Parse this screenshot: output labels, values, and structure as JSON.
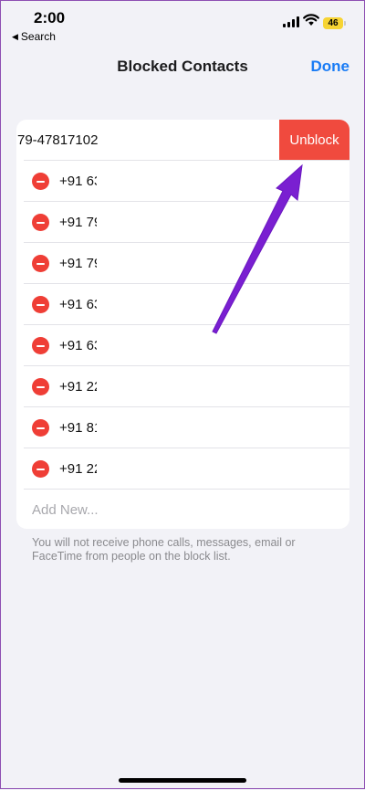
{
  "status_bar": {
    "time": "2:00",
    "back_label": "Search",
    "back_icon": "triangle-left-icon",
    "battery_level": "46",
    "battery_color": "#f7d433"
  },
  "nav": {
    "title": "Blocked Contacts",
    "done_label": "Done",
    "accent_color": "#1a7cf5"
  },
  "list": {
    "swiped_row": {
      "number_text": "79-47817102",
      "action_label": "Unblock",
      "action_color": "#f04a3e"
    },
    "numbers": [
      "+91 63",
      "+91 79",
      "+91 79",
      "+91 63",
      "+91 63",
      "+91 22",
      "+91 81",
      "+91 22"
    ],
    "add_new_label": "Add New..."
  },
  "footer_note": "You will not receive phone calls, messages, email or FaceTime from people on the block list.",
  "annotation": {
    "icon": "arrow-icon",
    "color": "#7a1fd1"
  }
}
